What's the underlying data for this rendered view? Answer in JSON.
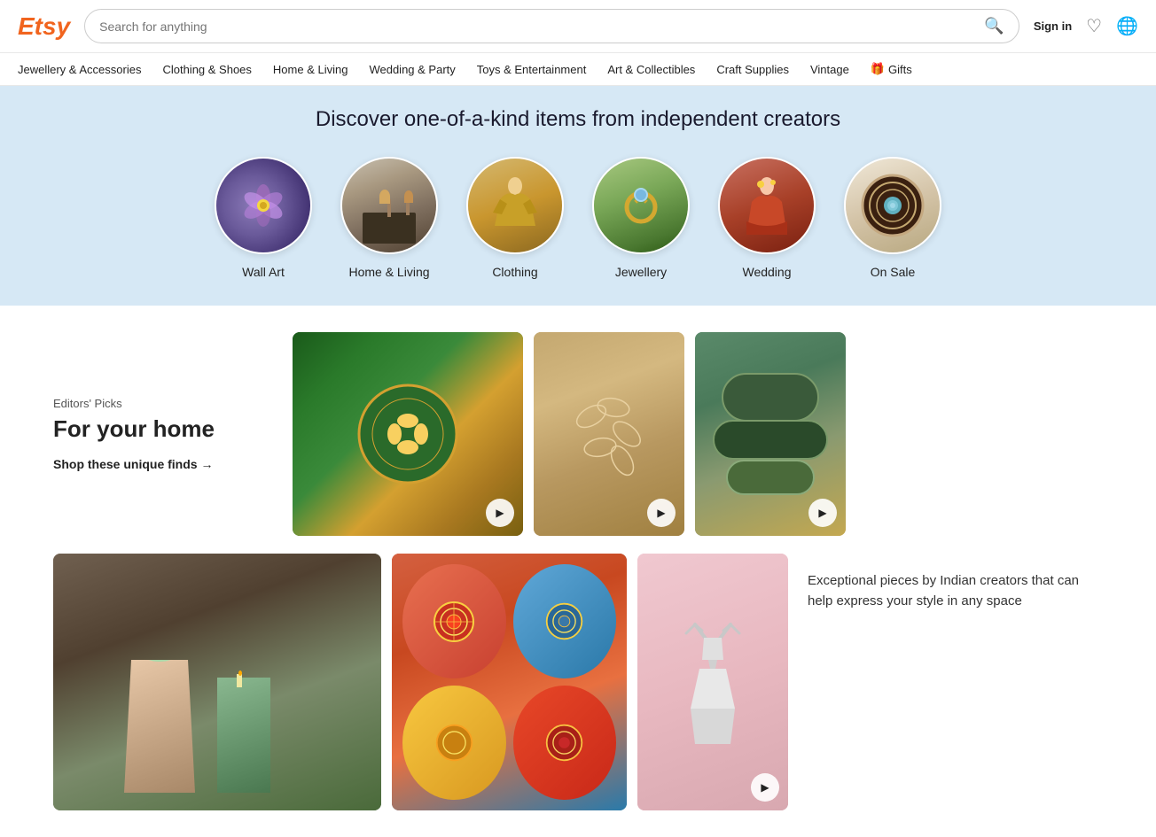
{
  "header": {
    "logo": "Etsy",
    "search_placeholder": "Search for anything",
    "sign_in": "Sign in",
    "icons": {
      "search": "🔍",
      "heart": "♡",
      "cart": "🌐"
    }
  },
  "nav": {
    "items": [
      {
        "label": "Jewellery & Accessories"
      },
      {
        "label": "Clothing & Shoes"
      },
      {
        "label": "Home & Living"
      },
      {
        "label": "Wedding & Party"
      },
      {
        "label": "Toys & Entertainment"
      },
      {
        "label": "Art & Collectibles"
      },
      {
        "label": "Craft Supplies"
      },
      {
        "label": "Vintage"
      },
      {
        "label": "Gifts",
        "icon": "🎁"
      }
    ]
  },
  "hero": {
    "headline": "Discover one-of-a-kind items from independent creators"
  },
  "categories": [
    {
      "label": "Wall Art",
      "id": "wall-art"
    },
    {
      "label": "Home & Living",
      "id": "home-living"
    },
    {
      "label": "Clothing",
      "id": "clothing"
    },
    {
      "label": "Jewellery",
      "id": "jewellery"
    },
    {
      "label": "Wedding",
      "id": "wedding"
    },
    {
      "label": "On Sale",
      "id": "on-sale"
    }
  ],
  "editors_picks": {
    "section_label": "Editors' Picks",
    "heading": "For your home",
    "shop_link": "Shop these unique finds →"
  },
  "description": {
    "text": "Exceptional pieces by Indian creators that can help express your style in any space"
  }
}
